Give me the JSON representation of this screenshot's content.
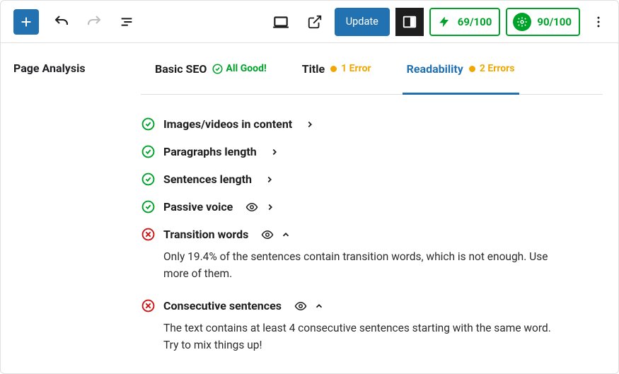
{
  "toolbar": {
    "update_label": "Update",
    "score1": "69/100",
    "score2": "90/100"
  },
  "sidebar": {
    "title": "Page Analysis"
  },
  "tabs": {
    "basic": {
      "label": "Basic SEO",
      "status": "All Good!"
    },
    "title": {
      "label": "Title",
      "status": "1 Error"
    },
    "readability": {
      "label": "Readability",
      "status": "2 Errors"
    }
  },
  "checks": {
    "images": {
      "label": "Images/videos in content"
    },
    "paragraphs": {
      "label": "Paragraphs length"
    },
    "sentences": {
      "label": "Sentences length"
    },
    "passive": {
      "label": "Passive voice"
    },
    "transition": {
      "label": "Transition words",
      "desc": "Only 19.4% of the sentences contain transition words, which is not enough. Use more of them."
    },
    "consecutive": {
      "label": "Consecutive sentences",
      "desc": "The text contains at least 4 consecutive sentences starting with the same word. Try to mix things up!"
    }
  }
}
